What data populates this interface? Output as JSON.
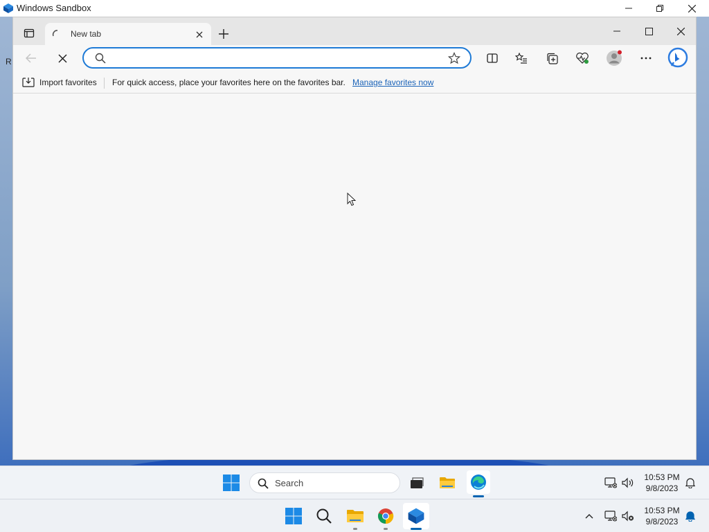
{
  "sandbox": {
    "title": "Windows Sandbox"
  },
  "desktop": {
    "stray_text": "R"
  },
  "edge": {
    "tab": {
      "title": "New tab"
    },
    "address_bar": {
      "value": "",
      "placeholder": ""
    },
    "favorites_bar": {
      "import_label": "Import favorites",
      "message": "For quick access, place your favorites here on the favorites bar.",
      "manage_link": "Manage favorites now"
    }
  },
  "taskbar_top": {
    "search_placeholder": "Search",
    "time": "10:53 PM",
    "date": "9/8/2023"
  },
  "taskbar_bottom": {
    "time": "10:53 PM",
    "date": "9/8/2023"
  },
  "colors": {
    "accent": "#1e7ad6",
    "link": "#1a63b8",
    "notification": "#0063b1"
  }
}
